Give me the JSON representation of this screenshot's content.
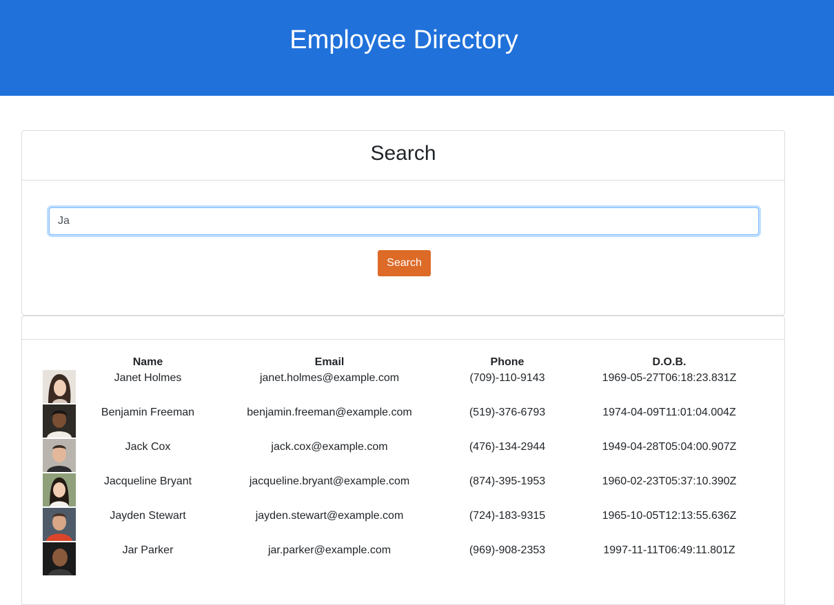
{
  "header": {
    "title": "Employee Directory"
  },
  "search": {
    "title": "Search",
    "query": "Ja",
    "button_label": "Search"
  },
  "table": {
    "columns": [
      "Name",
      "Email",
      "Phone",
      "D.O.B."
    ],
    "rows": [
      {
        "name": "Janet Holmes",
        "email": "janet.holmes@example.com",
        "phone": "(709)-110-9143",
        "dob": "1969-05-27T06:18:23.831Z"
      },
      {
        "name": "Benjamin Freeman",
        "email": "benjamin.freeman@example.com",
        "phone": "(519)-376-6793",
        "dob": "1974-04-09T11:01:04.004Z"
      },
      {
        "name": "Jack Cox",
        "email": "jack.cox@example.com",
        "phone": "(476)-134-2944",
        "dob": "1949-04-28T05:04:00.907Z"
      },
      {
        "name": "Jacqueline Bryant",
        "email": "jacqueline.bryant@example.com",
        "phone": "(874)-395-1953",
        "dob": "1960-02-23T05:37:10.390Z"
      },
      {
        "name": "Jayden Stewart",
        "email": "jayden.stewart@example.com",
        "phone": "(724)-183-9315",
        "dob": "1965-10-05T12:13:55.636Z"
      },
      {
        "name": "Jar Parker",
        "email": "jar.parker@example.com",
        "phone": "(969)-908-2353",
        "dob": "1997-11-11T06:49:11.801Z"
      }
    ]
  },
  "colors": {
    "header_bg": "#2071da",
    "button_bg": "#dd6a27"
  }
}
